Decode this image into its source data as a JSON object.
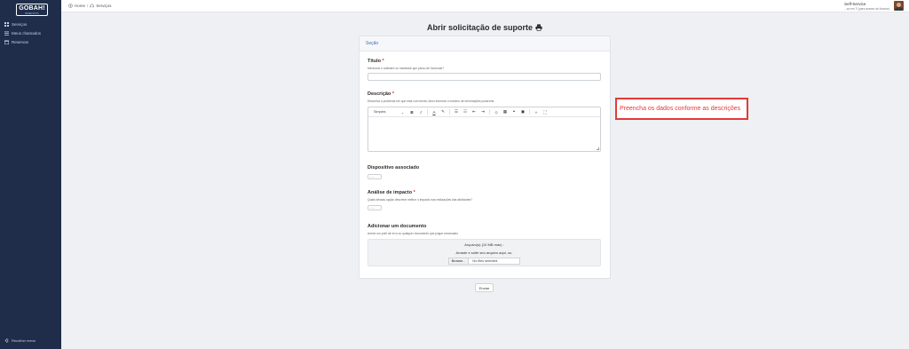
{
  "sidebar": {
    "logo": "GOBAH!",
    "logo_sub": "BENEFÍCIOS",
    "items": [
      {
        "label": "Serviços",
        "icon": "grid-icon"
      },
      {
        "label": "Meus chamados",
        "icon": "list-icon"
      },
      {
        "label": "Reservas",
        "icon": "calendar-icon"
      }
    ],
    "collapse_label": "Recolher menu"
  },
  "topbar": {
    "breadcrumb": [
      "Home",
      "Serviços"
    ],
    "user_name": "Self-Service",
    "user_status": "...ao em 7i (para acesso de Arcarar)"
  },
  "page": {
    "title": "Abrir solicitação de suporte",
    "section": "Seção"
  },
  "form": {
    "titulo": {
      "label": "Título",
      "required": "*",
      "help": "Mencione o software ou hardware que parou de funcionar?",
      "value": ""
    },
    "descricao": {
      "label": "Descrição",
      "required": "*",
      "help": "Descreva o problema em que está com tenda, favor informar o máximo de informações possíveis.",
      "toolbar_format": "Simples",
      "value": ""
    },
    "dispositivo": {
      "label": "Dispositivo associado",
      "value": "------"
    },
    "impacto": {
      "label": "Análise de impacto",
      "required": "*",
      "help": "Quais dessas opção descreve melhor o impacto nas realizações das atividades?",
      "value": "------"
    },
    "documento": {
      "label": "Adicionar um documento",
      "help": "Anexe um print de erro ou qualquer documento que julgue necessário",
      "upload_title": "Arquivo(s) (10 MB máx) :",
      "drop_text": "Arraste e solte seu arquivo aqui, ou.",
      "browse_label": "Browse...",
      "no_file": "No files selected."
    },
    "submit_label": "Enviar"
  },
  "callout": "Preencha os dados conforme as descrições",
  "colors": {
    "sidebar_bg": "#1f2d4a",
    "required": "#d93025",
    "callout": "#e53935",
    "section": "#3d6fb5"
  }
}
